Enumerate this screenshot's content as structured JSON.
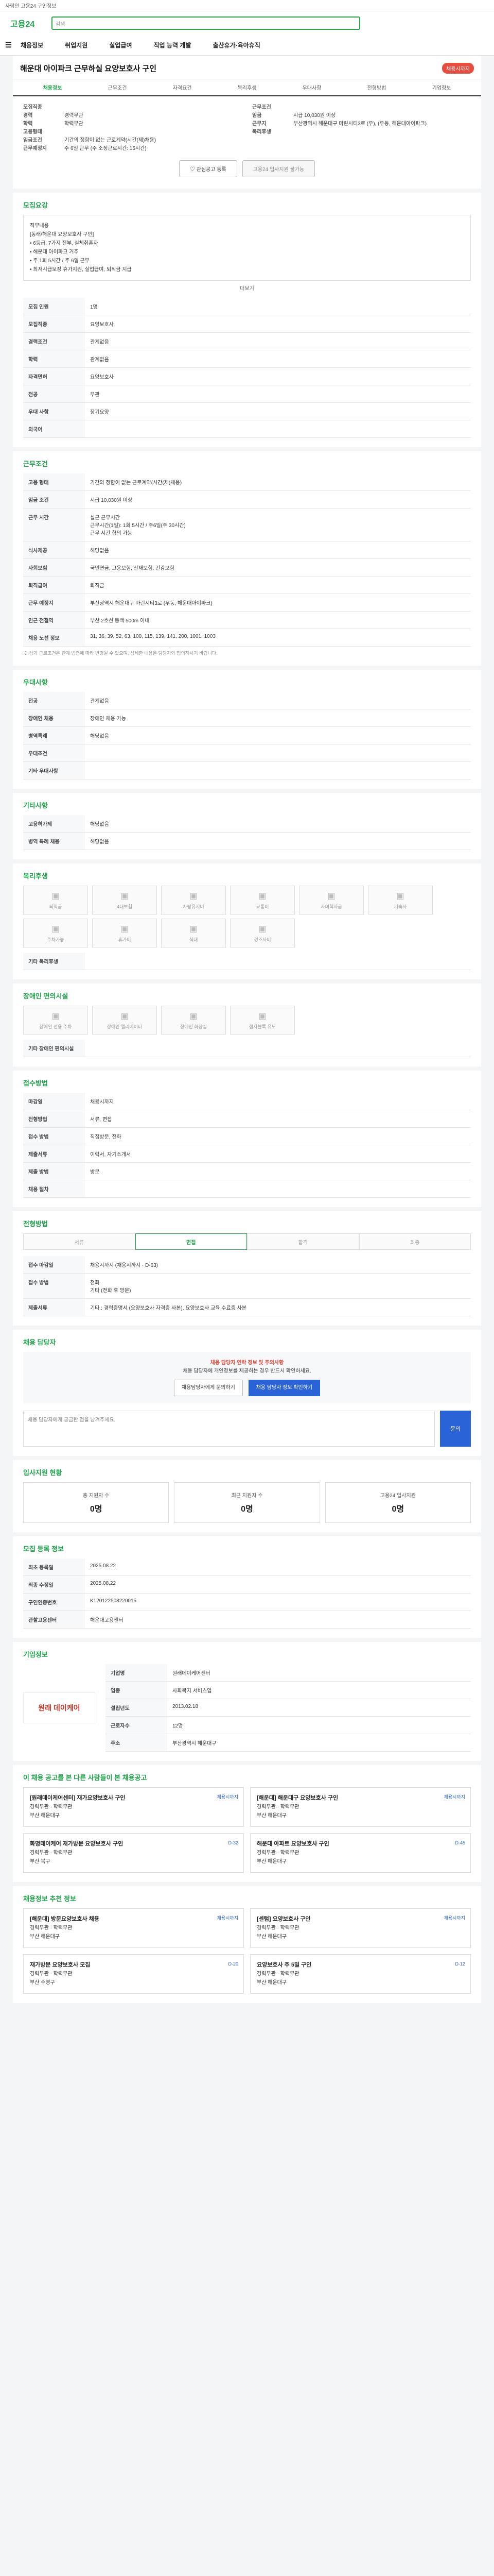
{
  "top": {
    "text": "사람인 고용24 구인정보"
  },
  "header": {
    "logo": "고용24",
    "search_placeholder": "검색"
  },
  "nav": [
    "채용정보",
    "취업지원",
    "실업급여",
    "직업 능력 개발",
    "출산휴가·육아휴직"
  ],
  "title": "해운대 아이파크 근무하실 요양보호사 구인",
  "title_badge": "채용시까지",
  "tabs": [
    "채용정보",
    "근무조건",
    "자격요건",
    "복리후생",
    "우대사항",
    "전형방법",
    "기업정보"
  ],
  "summary": {
    "left": [
      {
        "k": "모집직종",
        "v": ""
      },
      {
        "k": "경력",
        "v": "경력무관"
      },
      {
        "k": "학력",
        "v": "학력무관"
      },
      {
        "k": "고용형태",
        "v": ""
      },
      {
        "k": "임금조건",
        "v": "기간의 정함이 없는 근로계약(시간(제)채용)"
      },
      {
        "k": "근무예정지",
        "v": "주 6일 근무 (주 소정근로시간: 15시간)"
      }
    ],
    "right": [
      {
        "k": "근무조건",
        "v": ""
      },
      {
        "k": "임금",
        "v": "시급 10,030원 이상"
      },
      {
        "k": "근무지",
        "v": "부산광역시 해운대구 마린시티3로 (우), (우동, 해운대아이파크)"
      },
      {
        "k": "복리후생",
        "v": ""
      }
    ]
  },
  "buttons": {
    "scrap": "관심공고 등록",
    "apply": "고용24 입사지원 불가능"
  },
  "detail": {
    "title": "모집요강",
    "lines": [
      "직무내용",
      "[동래/해운대 요양보호사 구인]",
      "• 6등급, 7가지 전부, 실체취혼자",
      "• 해운대 아이파크 거주",
      "• 주 1회 5시간 / 주 6일 근무",
      "• 최저시급보장 휴가지원, 실업급여, 퇴직금 지급"
    ],
    "more": "더보기"
  },
  "recruit_table": [
    {
      "k": "모집 인원",
      "v": "1명"
    },
    {
      "k": "모집직종",
      "v": "요양보호사"
    },
    {
      "k": "경력조건",
      "v": "관계없음"
    },
    {
      "k": "학력",
      "v": "관계없음"
    },
    {
      "k": "자격면허",
      "v": "요양보호사"
    },
    {
      "k": "전공",
      "v": "무관"
    },
    {
      "k": "우대 사항",
      "v": "장기요양"
    },
    {
      "k": "외국어",
      "v": ""
    }
  ],
  "work": {
    "title": "근무조건",
    "rows": [
      {
        "k": "고용 형태",
        "v": "기간의 정함이 없는 근로계약(시간(제)채용)"
      },
      {
        "k": "임금 조건",
        "v": "시급 10,030원 이상"
      },
      {
        "k": "근무 시간",
        "v": "실근 근무시간\n근무시간(1일): 1회 5시간 / 주6일(주 30시간)\n근무 시간 협의 가능"
      },
      {
        "k": "식사제공",
        "v": "해당없음"
      },
      {
        "k": "사회보험",
        "v": "국민연금, 고용보험, 산재보험, 건강보험"
      },
      {
        "k": "퇴직급여",
        "v": "퇴직금"
      },
      {
        "k": "근무 예정지",
        "v": "부산광역시 해운대구 마린시티3로 (우동, 해운대아이파크)"
      },
      {
        "k": "인근 전철역",
        "v": "부산 2호선 동백 500m 이내"
      },
      {
        "k": "채용 노선 정보",
        "v": "31, 36, 39, 52, 63, 100, 115, 139, 141, 200, 1001, 1003"
      }
    ],
    "note": "※ 상기 근로조건은 관계 법령에 따라 변경될 수 있으며, 상세한 내용은 담당자와 협의하시기 바랍니다."
  },
  "qual": {
    "title": "우대사항",
    "rows": [
      {
        "k": "전공",
        "v": "관계없음"
      },
      {
        "k": "장애인 채용",
        "v": "장애인 채용 가능"
      },
      {
        "k": "병역특례",
        "v": "해당없음"
      },
      {
        "k": "우대조건",
        "v": ""
      },
      {
        "k": "기타 우대사항",
        "v": ""
      }
    ]
  },
  "etc": {
    "title": "기타사항",
    "rows": [
      {
        "k": "고용허가제",
        "v": "해당없음"
      },
      {
        "k": "병역 특례 채용",
        "v": "해당없음"
      }
    ]
  },
  "welfare": {
    "title": "복리후생",
    "items": [
      "퇴직금",
      "4대보험",
      "차량유지비",
      "교통비",
      "자녀학자금",
      "기숙사",
      "주차가능",
      "휴가비",
      "식대",
      "경조사비"
    ],
    "etc_label": "기타 복리후생"
  },
  "disability": {
    "title": "장애인 편의시설",
    "items": [
      "장애인 전용 주차",
      "장애인 엘리베이터",
      "장애인 화장실",
      "점자블록 유도"
    ],
    "etc_label": "기타 장애인 편의시설"
  },
  "apply": {
    "title": "접수방법",
    "rows": [
      {
        "k": "마감일",
        "v": "채용시까지"
      },
      {
        "k": "전형방법",
        "v": "서류, 면접"
      },
      {
        "k": "접수 방법",
        "v": "직접방문, 전화"
      },
      {
        "k": "제출서류",
        "v": "이력서, 자기소개서"
      },
      {
        "k": "제출 방법",
        "v": "방문"
      },
      {
        "k": "채용 절차",
        "v": ""
      }
    ]
  },
  "process": {
    "title": "전형방법",
    "steps": [
      "서류",
      "면접",
      "합격",
      "최종"
    ],
    "deadline_label": "접수 마감일",
    "deadline": "채용시까지 (채용시까지 · D-63)",
    "method_label": "접수 방법",
    "method": "전화\n기타 (전화 후 방문)",
    "docs_label": "제출서류",
    "docs": "기타 : 경력증명서 (요양보호사 자격증 사본), 요양보호사 교육 수료증 사본"
  },
  "agent": {
    "title": "채용 담당자",
    "warn": "채용 담당자 연락 정보 및 주의사항",
    "msg": "채용 담당자에 개인정보를 제공하는 경우 반드시 확인하세요.",
    "btn1": "채용담당자에게 문의하기",
    "btn2": "채용 담당자 정보 확인하기",
    "q_placeholder": "채용 담당자에게 궁금한 점을 남겨주세요.",
    "q_btn": "문의"
  },
  "status": {
    "title": "입사지원 현황",
    "cards": [
      {
        "k": "총 지원자 수",
        "v": "0명"
      },
      {
        "k": "최근 지원자 수",
        "v": "0명"
      },
      {
        "k": "고용24 입사지원",
        "v": "0명"
      }
    ]
  },
  "reg": {
    "title": "모집 등록 정보",
    "rows": [
      {
        "k": "최초 등록일",
        "v": "2025.08.22"
      },
      {
        "k": "최종 수정일",
        "v": "2025.08.22"
      },
      {
        "k": "구인인증번호",
        "v": "K120122508220015"
      },
      {
        "k": "관할고용센터",
        "v": "해운대고용센터"
      }
    ]
  },
  "company": {
    "title": "기업정보",
    "logo": "원래 데이케어",
    "rows": [
      {
        "k": "기업명",
        "v": "원래데이케어센터"
      },
      {
        "k": "업종",
        "v": "사회복지 서비스업"
      },
      {
        "k": "설립년도",
        "v": "2013.02.18"
      },
      {
        "k": "근로자수",
        "v": "12명"
      },
      {
        "k": "주소",
        "v": "부산광역시 해운대구"
      }
    ]
  },
  "related": {
    "title": "이 채용 공고를 본 다른 사람들이 본 채용공고",
    "jobs": [
      {
        "t": "[원래데이케어센터] 재가요양보호사 구인",
        "d": "경력무관 · 학력무관",
        "l": "부산 해운대구",
        "b": "채용시까지"
      },
      {
        "t": "[해운대] 해운대구 요양보호사 구인",
        "d": "경력무관 · 학력무관",
        "l": "부산 해운대구",
        "b": "채용시까지"
      },
      {
        "t": "화명데이케어 재가방문 요양보호사 구인",
        "d": "경력무관 · 학력무관",
        "l": "부산 북구",
        "b": "D-32"
      },
      {
        "t": "해운대 아파트 요양보호사 구인",
        "d": "경력무관 · 학력무관",
        "l": "부산 해운대구",
        "b": "D-45"
      }
    ]
  },
  "nearby": {
    "title": "채용정보 추천 정보",
    "jobs": [
      {
        "t": "[해운대] 방문요양보호사 채용",
        "d": "경력무관 · 학력무관",
        "l": "부산 해운대구",
        "b": "채용시까지"
      },
      {
        "t": "[센텀] 요양보호사 구인",
        "d": "경력무관 · 학력무관",
        "l": "부산 해운대구",
        "b": "채용시까지"
      },
      {
        "t": "재가방문 요양보호사 모집",
        "d": "경력무관 · 학력무관",
        "l": "부산 수영구",
        "b": "D-20"
      },
      {
        "t": "요양보호사 주 5일 구인",
        "d": "경력무관 · 학력무관",
        "l": "부산 해운대구",
        "b": "D-12"
      }
    ]
  }
}
